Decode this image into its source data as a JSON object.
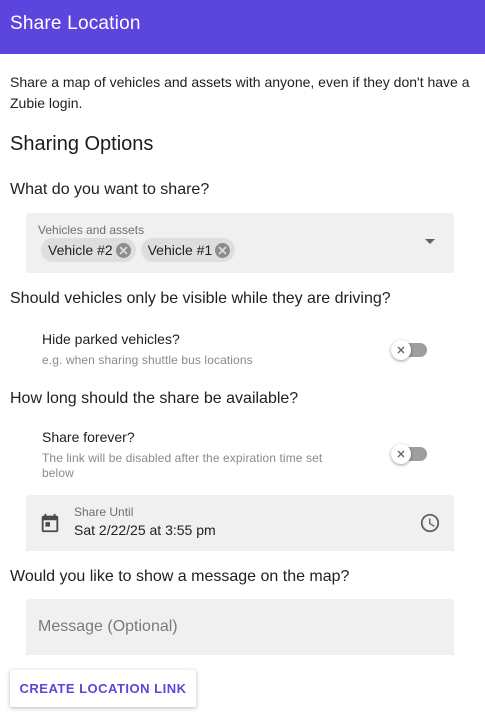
{
  "header": {
    "title": "Share Location"
  },
  "intro": {
    "text": "Share a map of vehicles and assets with anyone, even if they don't have a Zubie login."
  },
  "options": {
    "title": "Sharing Options"
  },
  "what_to_share": {
    "question": "What do you want to share?",
    "field_label": "Vehicles and assets",
    "chips": [
      {
        "label": "Vehicle #2"
      },
      {
        "label": "Vehicle #1"
      }
    ]
  },
  "visibility": {
    "question": "Should vehicles only be visible while they are driving?",
    "toggle_title": "Hide parked vehicles?",
    "toggle_desc": "e.g. when sharing shuttle bus locations",
    "toggle_on": false
  },
  "duration": {
    "question": "How long should the share be available?",
    "toggle_title": "Share forever?",
    "toggle_desc": "The link will be disabled after the expiration time set below",
    "toggle_on": false,
    "date_label": "Share Until",
    "date_value": "Sat 2/22/25 at 3:55 pm"
  },
  "message": {
    "question": "Would you like to show a message on the map?",
    "placeholder": "Message (Optional)",
    "value": ""
  },
  "actions": {
    "create_label": "CREATE LOCATION LINK"
  },
  "colors": {
    "brand": "#5c45dc",
    "field_bg": "#f0f0f0",
    "chip_bg": "#dedede"
  }
}
